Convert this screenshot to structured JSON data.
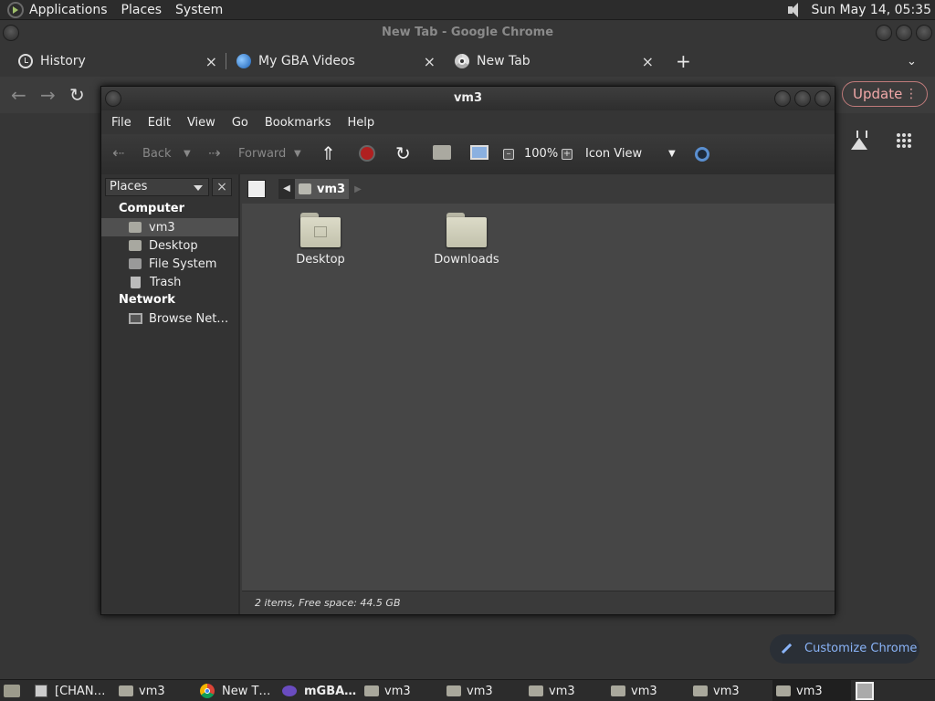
{
  "top_panel": {
    "menus": [
      "Applications",
      "Places",
      "System"
    ],
    "clock": "Sun May 14, 05:35"
  },
  "chrome": {
    "window_title": "New Tab - Google Chrome",
    "tabs": [
      {
        "label": "History",
        "icon": "history-icon"
      },
      {
        "label": "My GBA Videos",
        "icon": "gba-icon"
      },
      {
        "label": "New Tab",
        "icon": "chrome-icon"
      }
    ],
    "new_tab_symbol": "+",
    "close_symbol": "×",
    "update_label": "Update",
    "customize_label": "Customize Chrome"
  },
  "nautilus": {
    "title": "vm3",
    "menu": [
      "File",
      "Edit",
      "View",
      "Go",
      "Bookmarks",
      "Help"
    ],
    "toolbar": {
      "back": "Back",
      "forward": "Forward",
      "zoom": "100%",
      "view_mode": "Icon View"
    },
    "sidebar": {
      "selector": "Places",
      "close": "×",
      "computer_header": "Computer",
      "computer_items": [
        "vm3",
        "Desktop",
        "File System",
        "Trash"
      ],
      "network_header": "Network",
      "network_items": [
        "Browse Net…"
      ]
    },
    "pathbar": {
      "current": "vm3"
    },
    "files": [
      "Desktop",
      "Downloads"
    ],
    "status": "2 items, Free space: 44.5 GB"
  },
  "taskbar": {
    "items": [
      "[CHAN…",
      "vm3",
      "New T…",
      "mGBA…",
      "vm3",
      "vm3",
      "vm3",
      "vm3",
      "vm3",
      "vm3"
    ]
  }
}
